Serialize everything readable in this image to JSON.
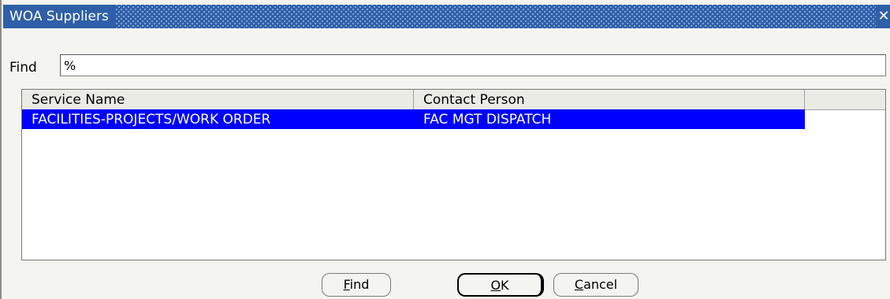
{
  "window": {
    "title": "WOA Suppliers",
    "close_glyph": "✕"
  },
  "find": {
    "label": "Find",
    "value": "%"
  },
  "list": {
    "columns": [
      "Service Name",
      "Contact Person"
    ],
    "rows": [
      {
        "service_name": "FACILITIES-PROJECTS/WORK ORDER",
        "contact_person": "FAC MGT DISPATCH",
        "selected": true
      }
    ],
    "selection_color": "#0000ff"
  },
  "buttons": {
    "find": {
      "mnemonic": "F",
      "rest": "ind"
    },
    "ok": {
      "mnemonic": "O",
      "rest": "K"
    },
    "cancel": {
      "mnemonic": "C",
      "rest": "ancel"
    }
  },
  "colors": {
    "titlebar": "#2f5fa8",
    "dialog_bg": "#f4f4f0"
  }
}
